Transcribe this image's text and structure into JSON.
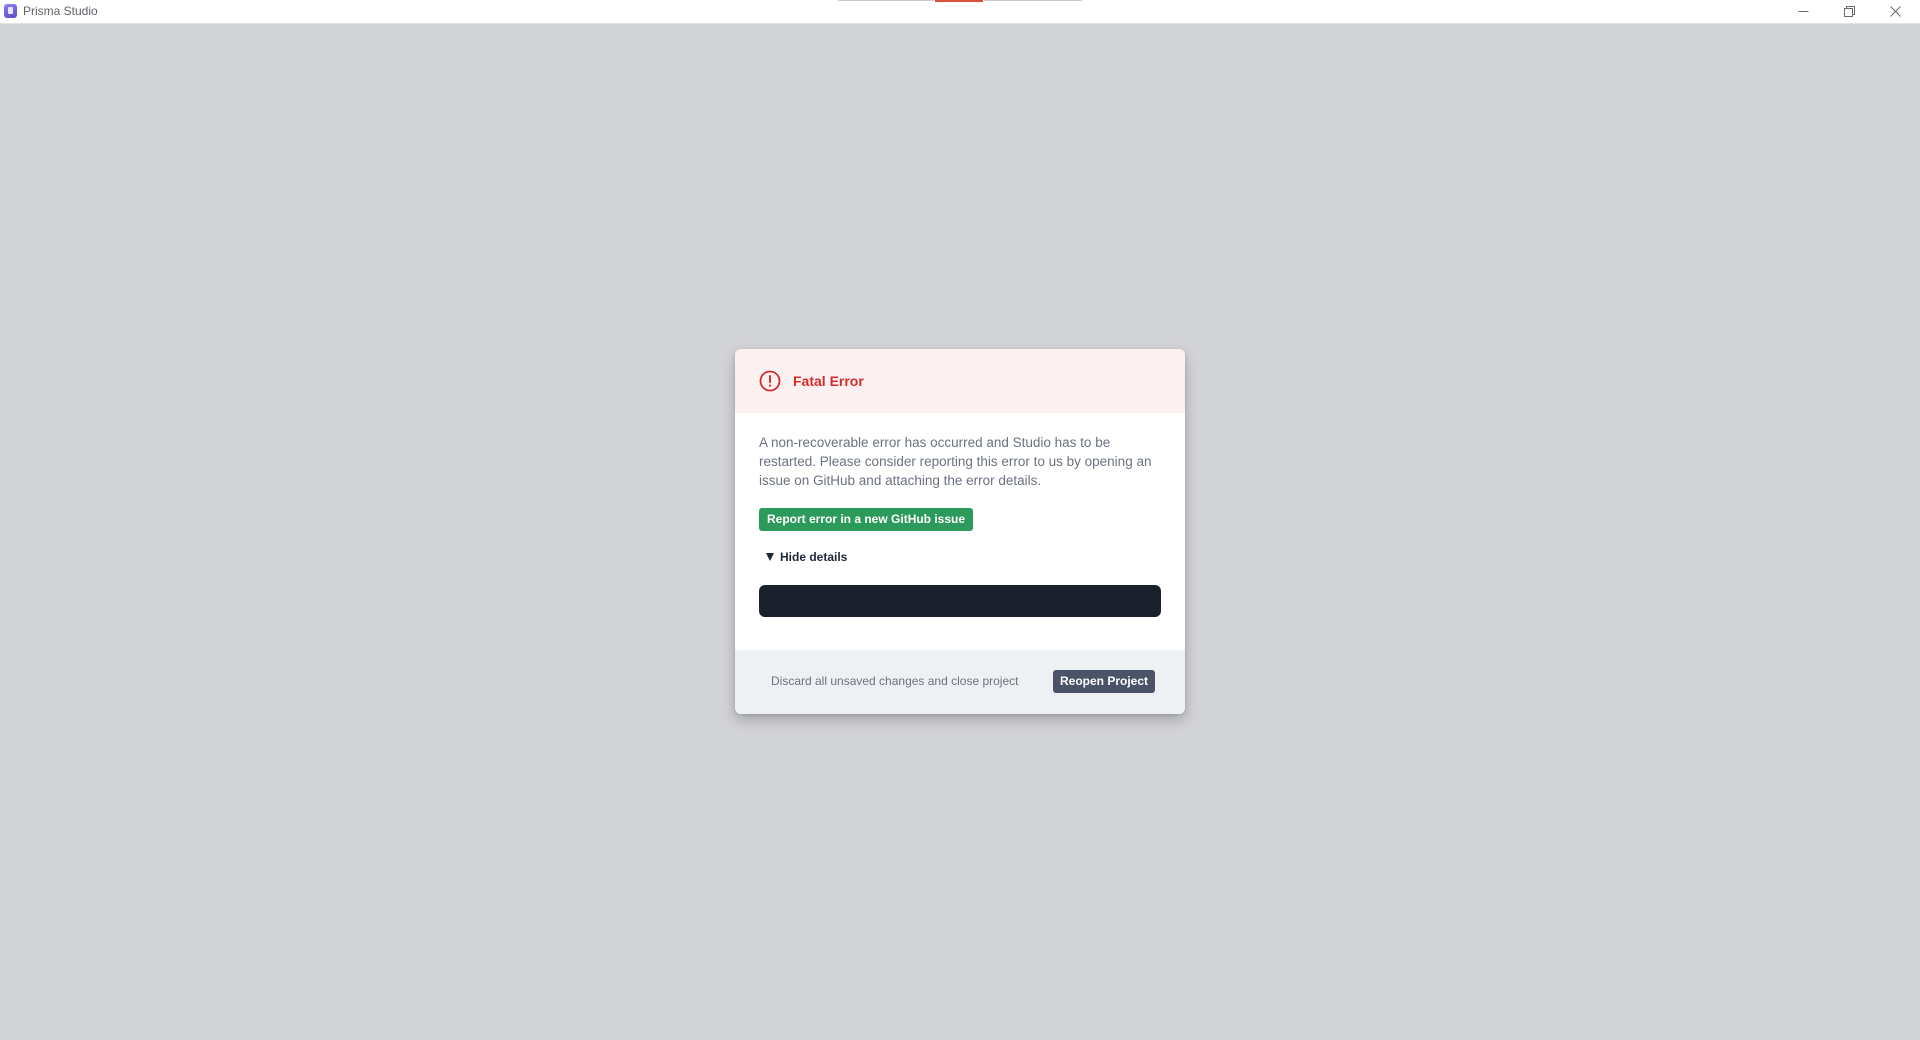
{
  "window": {
    "title": "Prisma Studio",
    "icon": "prisma-studio-app-icon",
    "controls": [
      "minimize-icon",
      "restore-icon",
      "close-icon"
    ]
  },
  "modal": {
    "title": "Fatal Error",
    "icon": "alert-circle-icon",
    "message": "A non-recoverable error has occurred and Studio has to be restarted. Please consider reporting this error to us by opening an issue on GitHub and attaching the error details.",
    "report_button_label": "Report error in a new GitHub issue",
    "details_toggle_label": "Hide details",
    "details_toggle_icon": "triangle-down-icon",
    "error_details_text": "",
    "discard_label": "Discard all unsaved changes and close project",
    "reopen_button_label": "Reopen Project"
  },
  "colors": {
    "backdrop": "#d2d3d6",
    "error_red": "#d22d2d",
    "header_bg": "#fdf0f0",
    "report_green": "#2c9a5a",
    "details_bg": "#1b212c",
    "footer_bg": "#eef1f4",
    "reopen_button_bg": "#4b5368"
  }
}
